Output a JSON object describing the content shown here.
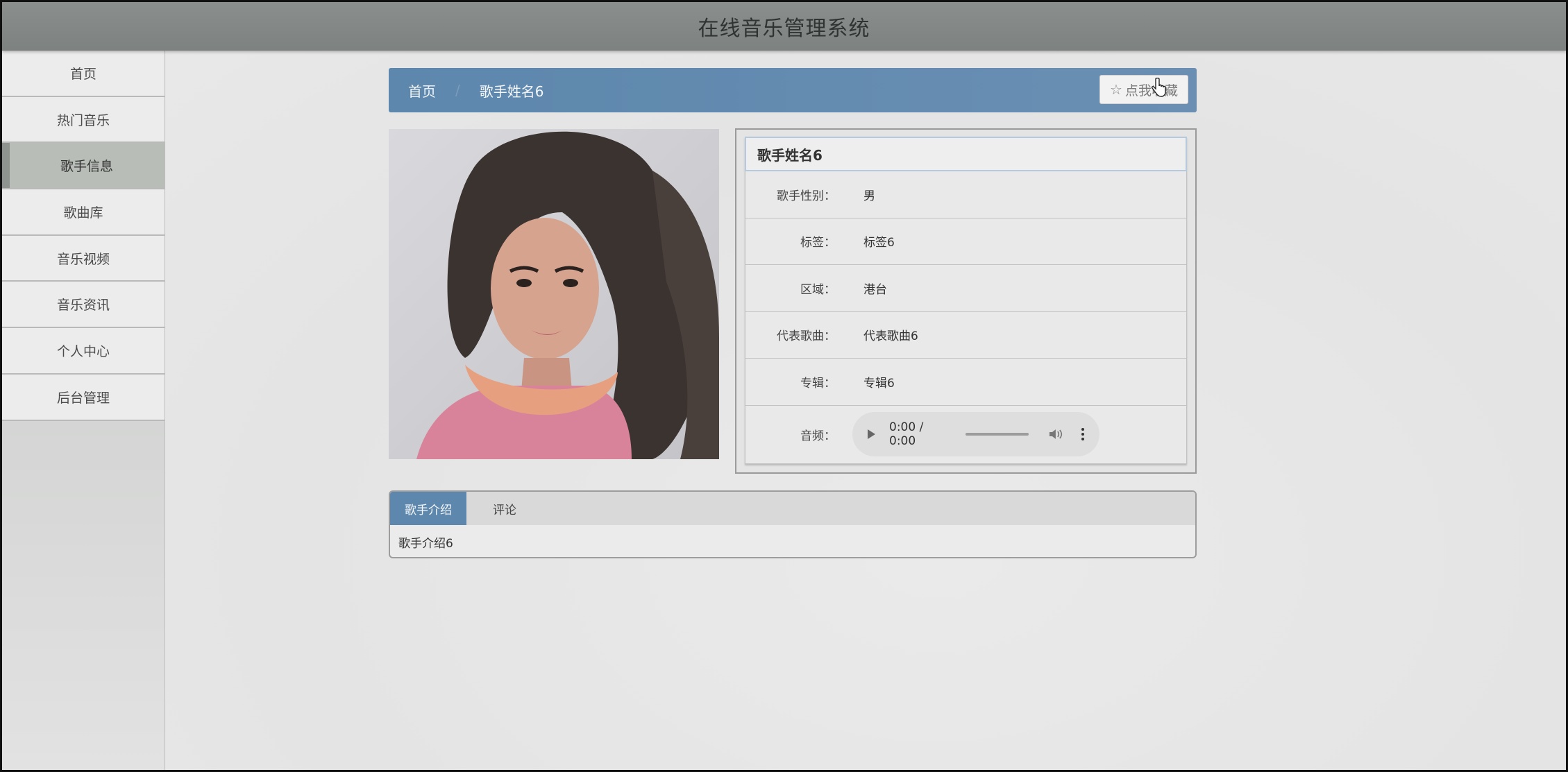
{
  "header": {
    "title": "在线音乐管理系统"
  },
  "sidebar": {
    "items": [
      {
        "label": "首页"
      },
      {
        "label": "热门音乐"
      },
      {
        "label": "歌手信息"
      },
      {
        "label": "歌曲库"
      },
      {
        "label": "音乐视频"
      },
      {
        "label": "音乐资讯"
      },
      {
        "label": "个人中心"
      },
      {
        "label": "后台管理"
      }
    ],
    "active_index": 2
  },
  "breadcrumb": {
    "home": "首页",
    "separator": "/",
    "current": "歌手姓名6"
  },
  "favorite_button": {
    "icon": "star-icon",
    "label": "点我收藏"
  },
  "singer": {
    "name": "歌手姓名6",
    "rows": [
      {
        "key": "歌手性别：",
        "value": "男"
      },
      {
        "key": "标签：",
        "value": "标签6"
      },
      {
        "key": "区域：",
        "value": "港台"
      },
      {
        "key": "代表歌曲：",
        "value": "代表歌曲6"
      },
      {
        "key": "专辑：",
        "value": "专辑6"
      }
    ],
    "audio": {
      "key": "音频：",
      "time": "0:00 / 0:00"
    }
  },
  "tabs": {
    "items": [
      {
        "label": "歌手介绍"
      },
      {
        "label": "评论"
      }
    ],
    "active_index": 0,
    "content": "歌手介绍6"
  },
  "colors": {
    "accent": "#5d87ad",
    "header": "#858a88"
  }
}
